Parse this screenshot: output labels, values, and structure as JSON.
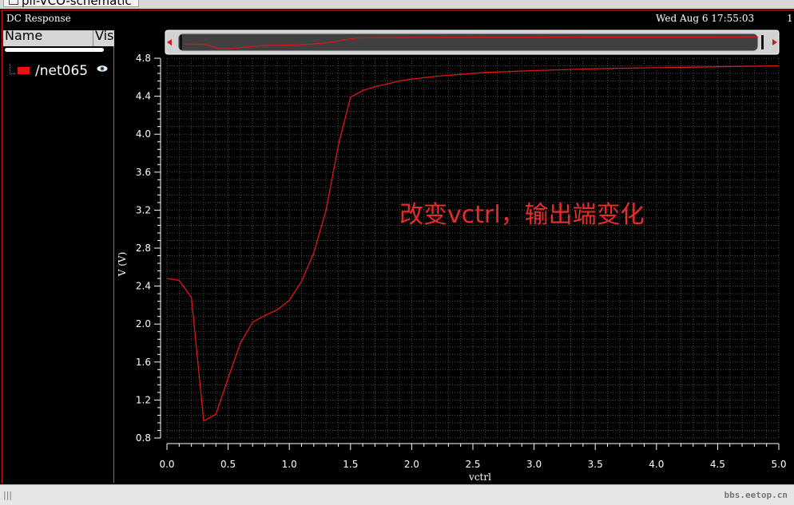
{
  "top_tab": {
    "label": "pll-VCO-schematic"
  },
  "window": {
    "title": "DC Response",
    "datetime": "Wed Aug 6 17:55:03",
    "page_number": "1"
  },
  "legend": {
    "columns": [
      "Name",
      "Vis"
    ],
    "items": [
      {
        "label": "/net065",
        "color": "#e01515",
        "visible_icon": "eye-icon"
      }
    ]
  },
  "annotation": {
    "text": "改变vctrl，输出端变化",
    "color": "#e82b2b"
  },
  "watermark": "bbs.eetop.cn",
  "colors": {
    "trace": "#e01515",
    "frame": "#c91818"
  },
  "chart_data": {
    "type": "line",
    "xlabel": "vctrl",
    "ylabel": "V (V)",
    "xlim": [
      0.0,
      5.0
    ],
    "ylim": [
      0.8,
      4.8
    ],
    "xticks": [
      "0.0",
      "0.5",
      "1.0",
      "1.5",
      "2.0",
      "2.5",
      "3.0",
      "3.5",
      "4.0",
      "4.5",
      "5.0"
    ],
    "yticks": [
      "0.8",
      "1.2",
      "1.6",
      "2.0",
      "2.4",
      "2.8",
      "3.2",
      "3.6",
      "4.0",
      "4.4",
      "4.8"
    ],
    "grid": true,
    "series": [
      {
        "name": "/net065",
        "x": [
          0.0,
          0.1,
          0.2,
          0.3,
          0.4,
          0.5,
          0.6,
          0.7,
          0.8,
          0.9,
          1.0,
          1.1,
          1.2,
          1.3,
          1.4,
          1.5,
          1.6,
          1.7,
          1.8,
          1.9,
          2.0,
          2.2,
          2.4,
          2.6,
          2.8,
          3.0,
          3.5,
          4.0,
          4.5,
          5.0
        ],
        "values": [
          2.48,
          2.46,
          2.28,
          0.98,
          1.05,
          1.43,
          1.8,
          2.02,
          2.09,
          2.15,
          2.25,
          2.45,
          2.75,
          3.2,
          3.88,
          4.39,
          4.46,
          4.5,
          4.53,
          4.56,
          4.58,
          4.61,
          4.63,
          4.65,
          4.66,
          4.67,
          4.69,
          4.7,
          4.71,
          4.72
        ]
      }
    ]
  }
}
